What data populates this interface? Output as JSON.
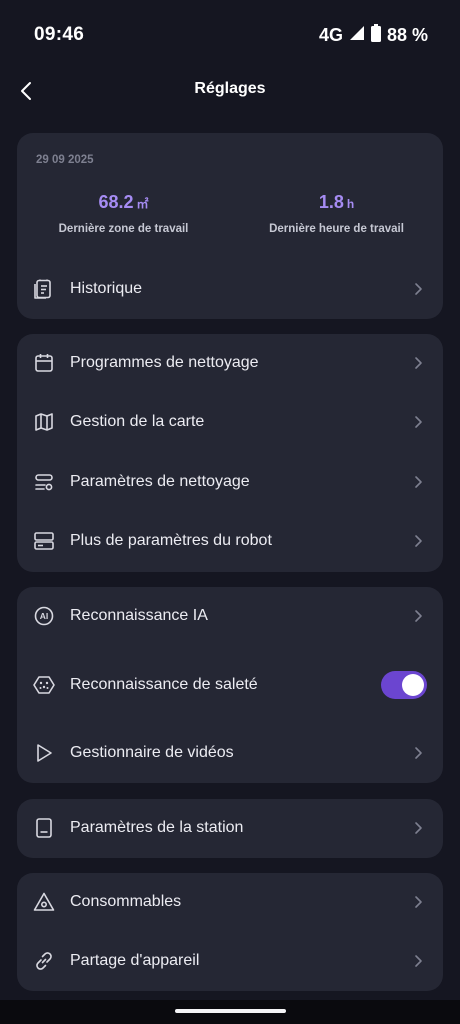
{
  "status_bar": {
    "time": "09:46",
    "network": "4G",
    "battery": "88 %"
  },
  "header": {
    "title": "Réglages",
    "back_icon": "chevron-left-icon"
  },
  "summary": {
    "date": "29 09 2025",
    "area_value": "68.2",
    "area_unit": "㎡",
    "area_label": "Dernière zone de travail",
    "time_value": "1.8",
    "time_unit": "h",
    "time_label": "Dernière heure de travail",
    "history_label": "Historique"
  },
  "group_1": [
    {
      "label": "Programmes de nettoyage",
      "icon": "calendar-icon"
    },
    {
      "label": "Gestion de la carte",
      "icon": "map-icon"
    },
    {
      "label": "Paramètres de nettoyage",
      "icon": "sliders-icon"
    },
    {
      "label": "Plus de paramètres du robot",
      "icon": "server-icon"
    }
  ],
  "group_2": [
    {
      "label": "Reconnaissance IA",
      "icon": "ai-icon"
    },
    {
      "label": "Reconnaissance de saleté",
      "icon": "dirt-detection-icon",
      "toggle_on": true
    },
    {
      "label": "Gestionnaire de vidéos",
      "icon": "play-icon"
    }
  ],
  "group_3": [
    {
      "label": "Paramètres de la station",
      "icon": "station-icon"
    }
  ],
  "group_4": [
    {
      "label": "Consommables",
      "icon": "warning-triangle-icon"
    },
    {
      "label": "Partage d'appareil",
      "icon": "link-icon"
    }
  ],
  "colors": {
    "background": "#151621",
    "card": "#252734",
    "accent": "#a68cf3",
    "toggle": "#6b45d0"
  }
}
